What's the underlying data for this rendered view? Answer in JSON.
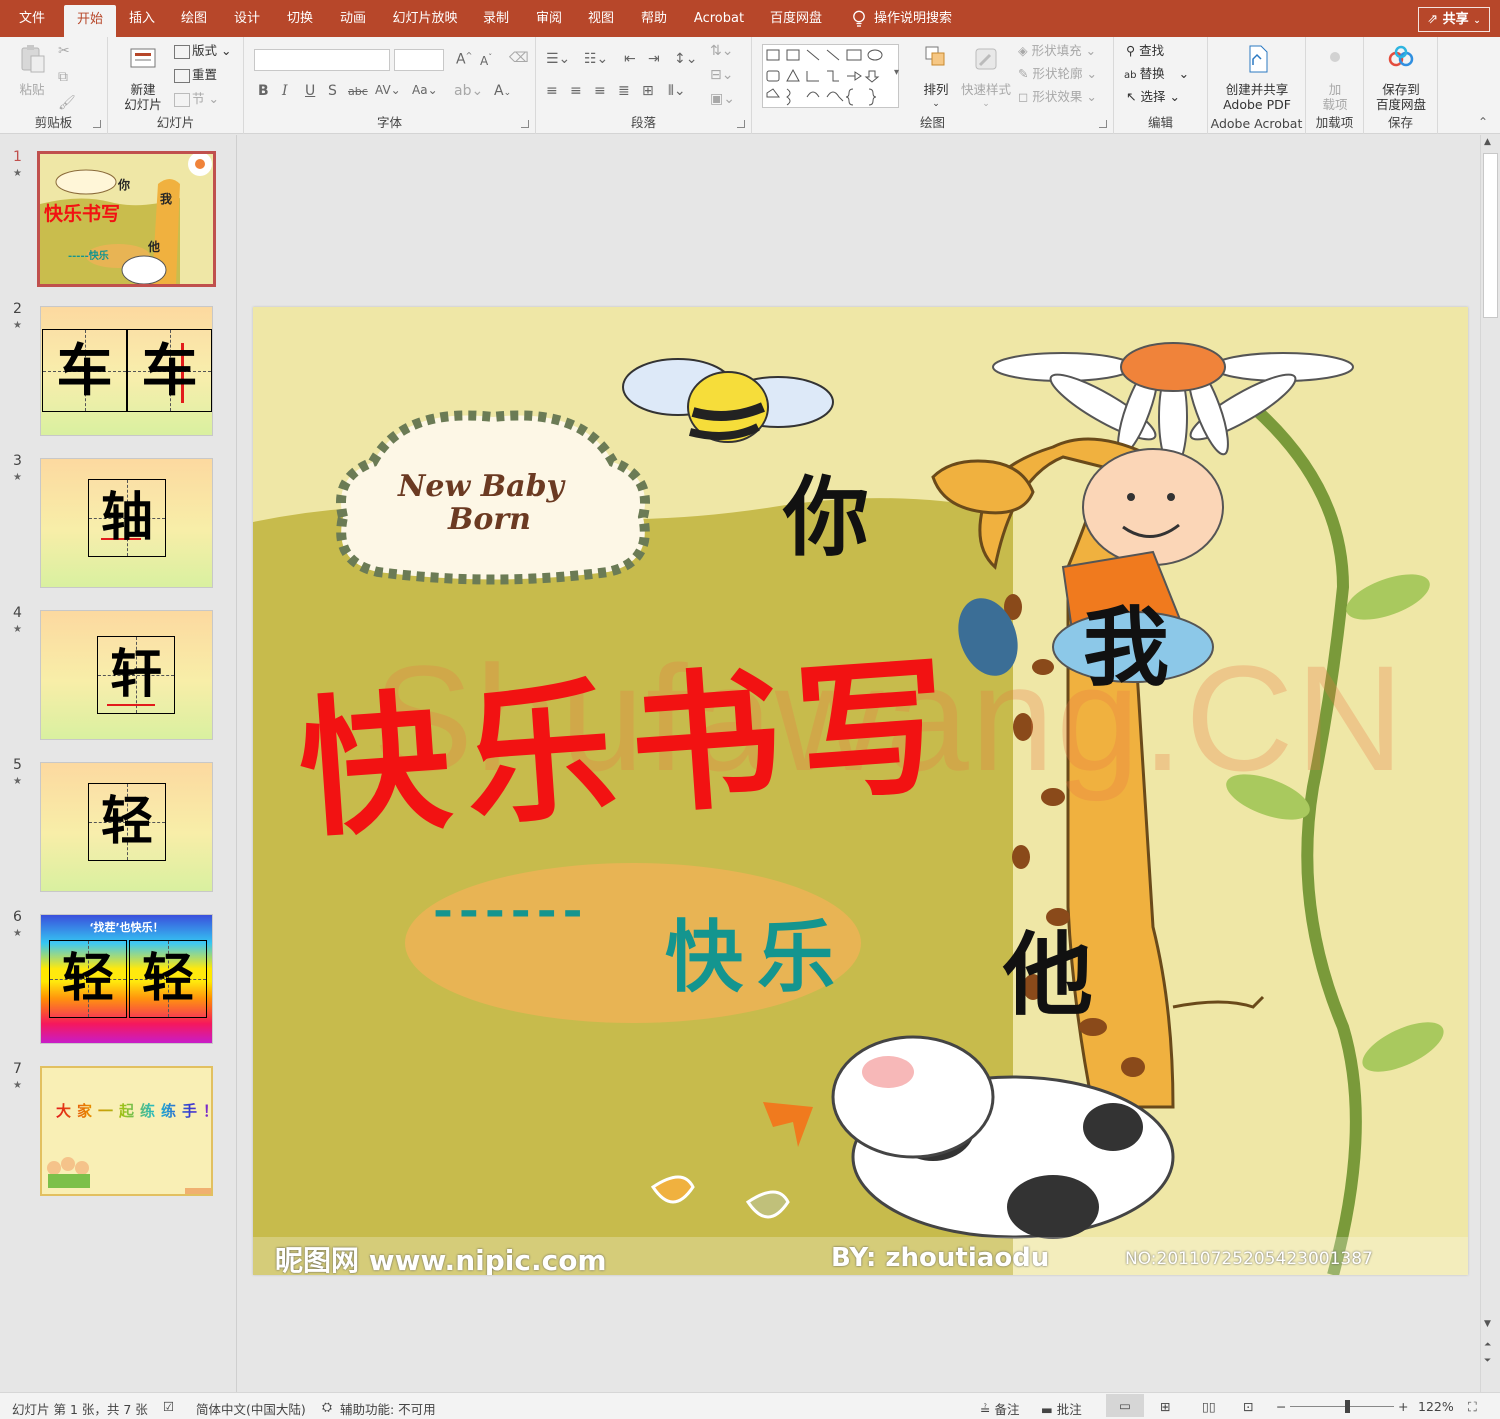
{
  "tabs": [
    {
      "label": "文件",
      "active": false
    },
    {
      "label": "开始",
      "active": true
    },
    {
      "label": "插入",
      "active": false
    },
    {
      "label": "绘图",
      "active": false
    },
    {
      "label": "设计",
      "active": false
    },
    {
      "label": "切换",
      "active": false
    },
    {
      "label": "动画",
      "active": false
    },
    {
      "label": "幻灯片放映",
      "active": false
    },
    {
      "label": "录制",
      "active": false
    },
    {
      "label": "审阅",
      "active": false
    },
    {
      "label": "视图",
      "active": false
    },
    {
      "label": "帮助",
      "active": false
    },
    {
      "label": "Acrobat",
      "active": false
    },
    {
      "label": "百度网盘",
      "active": false
    }
  ],
  "search_hint": "操作说明搜索",
  "share_label": "共享",
  "ribbon": {
    "clipboard": {
      "label": "剪贴板",
      "paste": "粘贴"
    },
    "slides": {
      "label": "幻灯片",
      "new_slide_line1": "新建",
      "new_slide_line2": "幻灯片",
      "layout": "版式",
      "reset": "重置",
      "section": "节"
    },
    "font": {
      "label": "字体"
    },
    "paragraph": {
      "label": "段落"
    },
    "drawing": {
      "label": "绘图",
      "arrange": "排列",
      "quick_styles": "快速样式",
      "shape_fill": "形状填充",
      "shape_outline": "形状轮廓",
      "shape_effects": "形状效果"
    },
    "editing": {
      "label": "编辑",
      "find": "查找",
      "replace": "替换",
      "select": "选择"
    },
    "acrobat": {
      "label": "Adobe Acrobat",
      "create_line1": "创建并共享",
      "create_line2": "Adobe PDF"
    },
    "addins": {
      "label": "加载项",
      "btn_line1": "加",
      "btn_line2": "载项"
    },
    "save": {
      "label": "保存",
      "btn_line1": "保存到",
      "btn_line2": "百度网盘"
    }
  },
  "thumbnails": [
    {
      "number": "1",
      "title_text": "快乐书写",
      "sub_text": "-----快乐",
      "side_a": "你",
      "side_b": "我",
      "side_c": "他"
    },
    {
      "number": "2",
      "chars": [
        "车",
        "车"
      ]
    },
    {
      "number": "3",
      "chars": [
        "轴"
      ]
    },
    {
      "number": "4",
      "chars": [
        "轩"
      ]
    },
    {
      "number": "5",
      "chars": [
        "轻"
      ]
    },
    {
      "number": "6",
      "header": "‘找茬’也快乐！",
      "chars": [
        "轻",
        "轻"
      ]
    },
    {
      "number": "7",
      "text": "大家一起练练手！"
    }
  ],
  "slide": {
    "badge_line1": "New Baby",
    "badge_line2": "Born",
    "title": "快乐书写",
    "subtitle_dashes": "------",
    "subtitle": "快乐",
    "word_you": "你",
    "word_me": "我",
    "word_him": "他",
    "watermark": "Shufawang.CN",
    "footer_left": "昵图网 www.nipic.com",
    "footer_by": "BY: zhoutiaodu",
    "footer_no": "NO:20110725205423001387",
    "colors": {
      "title": "#f21212",
      "subtitle": "#14958f",
      "background": "#efe7a6",
      "olive": "#c7bb4c"
    }
  },
  "status": {
    "slide_info": "幻灯片 第 1 张，共 7 张",
    "language": "简体中文(中国大陆)",
    "accessibility": "辅助功能: 不可用",
    "notes": "备注",
    "comments": "批注",
    "zoom": "122%",
    "zoom_level_fraction": 0.55
  }
}
